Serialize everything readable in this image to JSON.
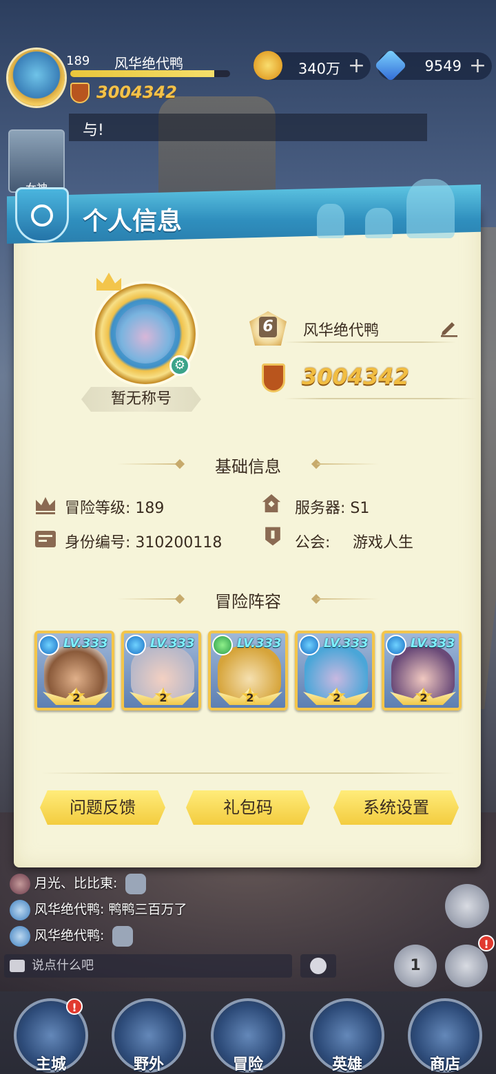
{
  "hud": {
    "level": "189",
    "name": "风华绝代鸭",
    "exp_fraction": 0.9,
    "power": "3004342",
    "gold": "340万",
    "gold_plus": "+",
    "gems": "9549",
    "gems_plus": "+"
  },
  "chat_strip": "与!",
  "side_card": "女神",
  "panel": {
    "title": "个人信息",
    "avatar_title": "暂无称号",
    "rank": "6",
    "name": "风华绝代鸭",
    "power": "3004342"
  },
  "basic_info": {
    "heading": "基础信息",
    "adventure_level": "冒险等级: 189",
    "server": "服务器: S1",
    "id": "身份编号: 310200118",
    "guild_label": "公会:",
    "guild_value": "游戏人生"
  },
  "lineup": {
    "heading": "冒险阵容",
    "heroes": [
      {
        "lv": "LV.333",
        "stars": "2",
        "element": "water"
      },
      {
        "lv": "LV.333",
        "stars": "2",
        "element": "water"
      },
      {
        "lv": "LV.333",
        "stars": "2",
        "element": "wind"
      },
      {
        "lv": "LV.333",
        "stars": "2",
        "element": "water"
      },
      {
        "lv": "LV.333",
        "stars": "2",
        "element": "water"
      }
    ]
  },
  "buttons": {
    "feedback": "问题反馈",
    "gift_code": "礼包码",
    "settings": "系统设置"
  },
  "chat": {
    "messages": [
      {
        "text": "月光、比比東:"
      },
      {
        "text": "风华绝代鸭: 鸭鸭三百万了"
      },
      {
        "text": "风华绝代鸭:"
      }
    ],
    "input_placeholder": "说点什么吧"
  },
  "nav": {
    "items": [
      {
        "label": "主城",
        "badge": "!"
      },
      {
        "label": "野外"
      },
      {
        "label": "冒险"
      },
      {
        "label": "英雄"
      },
      {
        "label": "商店"
      }
    ]
  },
  "side_buttons": {
    "rank_label": "1",
    "quest_badge": "!"
  },
  "colors": {
    "panel_bg": "#f6f4d9",
    "header_blue": "#2f8fbe",
    "gold_text": "#f1bd41",
    "button_yellow": "#f3cc3f"
  }
}
